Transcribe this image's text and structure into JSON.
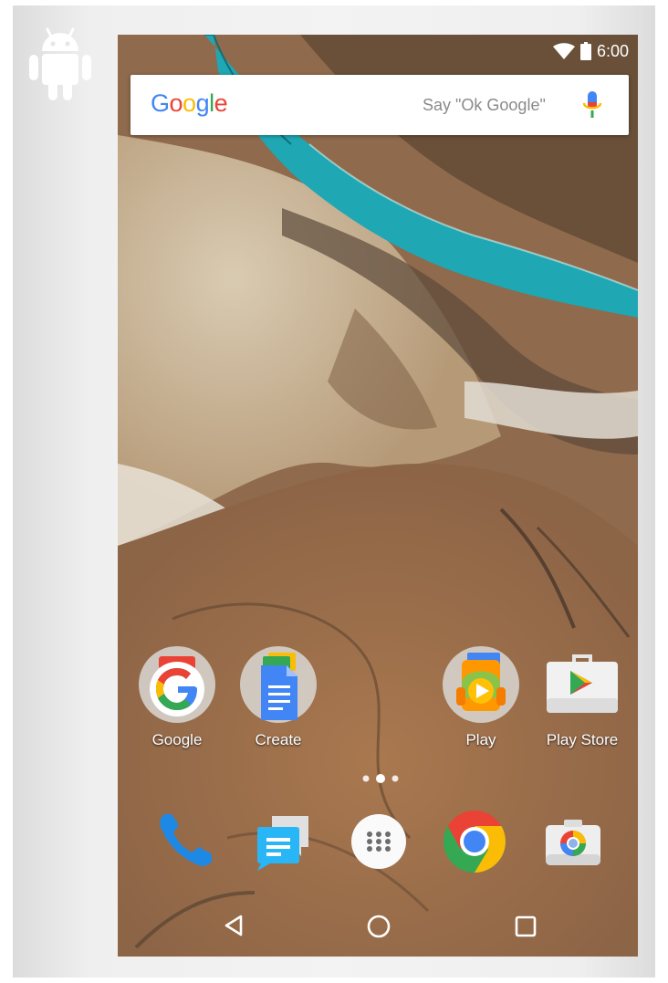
{
  "status_bar": {
    "time": "6:00",
    "icons": [
      "wifi-icon",
      "battery-icon"
    ]
  },
  "search": {
    "brand": [
      "G",
      "o",
      "o",
      "g",
      "l",
      "e"
    ],
    "brand_colors": [
      "#4285F4",
      "#EA4335",
      "#FBBC05",
      "#4285F4",
      "#34A853",
      "#EA4335"
    ],
    "hint": "Say \"Ok Google\"",
    "mic_icon": "microphone-icon"
  },
  "home_apps": [
    {
      "label": "Google",
      "icon": "google-folder-icon"
    },
    {
      "label": "Create",
      "icon": "docs-folder-icon"
    },
    {
      "label": "Play",
      "icon": "play-folder-icon"
    },
    {
      "label": "Play Store",
      "icon": "play-store-icon"
    }
  ],
  "page_indicator": {
    "pages": 3,
    "current": 2
  },
  "dock": [
    {
      "icon": "phone-icon"
    },
    {
      "icon": "messenger-icon"
    },
    {
      "icon": "app-drawer-icon"
    },
    {
      "icon": "chrome-icon"
    },
    {
      "icon": "camera-icon"
    }
  ],
  "nav_bar": [
    "back-icon",
    "home-icon",
    "recents-icon"
  ],
  "colors": {
    "river": "#1fa7b3",
    "google_blue": "#4285F4",
    "google_red": "#EA4335",
    "google_yellow": "#FBBC05",
    "google_green": "#34A853"
  }
}
